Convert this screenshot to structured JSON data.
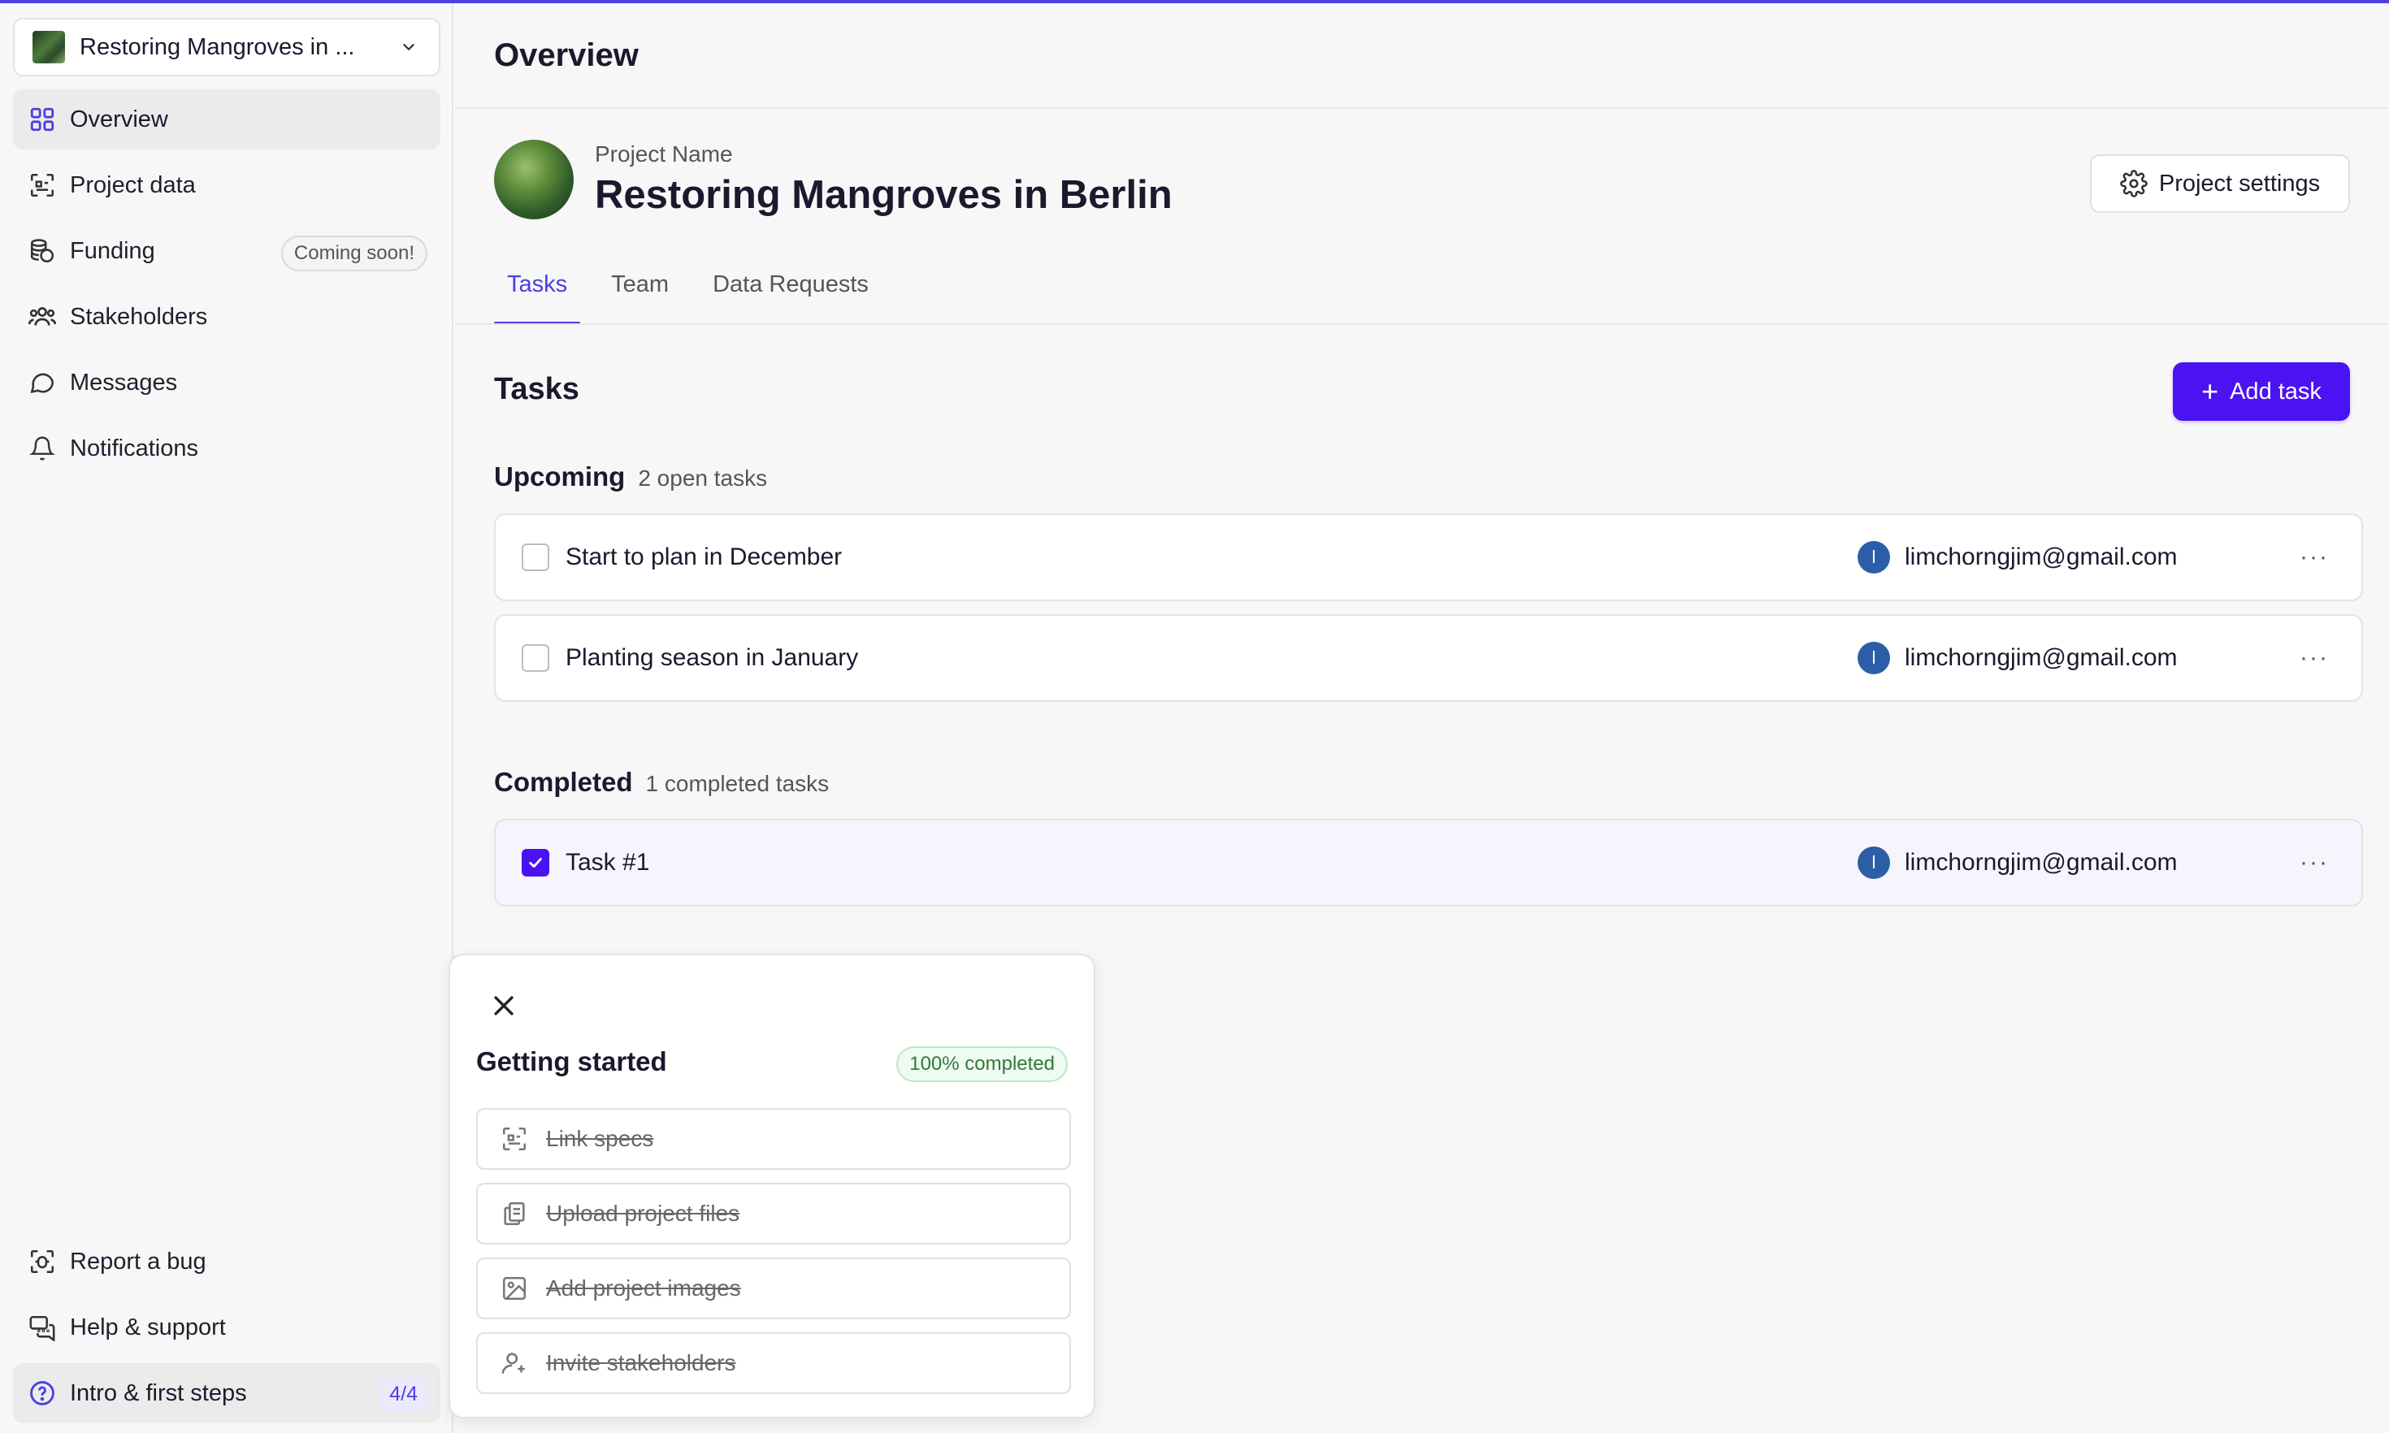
{
  "sidebar": {
    "project_select": "Restoring Mangroves in ...",
    "items": [
      {
        "label": "Overview",
        "icon": "grid-icon"
      },
      {
        "label": "Project data",
        "icon": "data-icon"
      },
      {
        "label": "Funding",
        "icon": "coins-icon",
        "badge": "Coming soon!"
      },
      {
        "label": "Stakeholders",
        "icon": "users-icon"
      },
      {
        "label": "Messages",
        "icon": "message-icon"
      },
      {
        "label": "Notifications",
        "icon": "bell-icon"
      }
    ],
    "bottom_items": [
      {
        "label": "Report a bug",
        "icon": "bug-icon"
      },
      {
        "label": "Help & support",
        "icon": "chat-icon"
      },
      {
        "label": "Intro & first steps",
        "icon": "question-icon",
        "count": "4/4"
      }
    ]
  },
  "header": {
    "title": "Overview"
  },
  "project": {
    "label": "Project Name",
    "name": "Restoring Mangroves in Berlin",
    "settings_label": "Project settings"
  },
  "tabs": [
    "Tasks",
    "Team",
    "Data Requests"
  ],
  "tasks": {
    "title": "Tasks",
    "add_label": "Add task",
    "upcoming": {
      "title": "Upcoming",
      "sub": "2 open tasks",
      "items": [
        {
          "name": "Start to plan in December",
          "assignee": "limchorngjim@gmail.com",
          "initial": "l"
        },
        {
          "name": "Planting season in January",
          "assignee": "limchorngjim@gmail.com",
          "initial": "l"
        }
      ]
    },
    "completed": {
      "title": "Completed",
      "sub": "1 completed tasks",
      "items": [
        {
          "name": "Task #1",
          "assignee": "limchorngjim@gmail.com",
          "initial": "l"
        }
      ]
    },
    "more": "···"
  },
  "getting_started": {
    "title": "Getting started",
    "badge": "100% completed",
    "progress": 1.0,
    "items": [
      {
        "label": "Link specs",
        "icon": "link-specs-icon"
      },
      {
        "label": "Upload project files",
        "icon": "files-icon"
      },
      {
        "label": "Add project images",
        "icon": "image-icon"
      },
      {
        "label": "Invite stakeholders",
        "icon": "user-plus-icon"
      }
    ]
  },
  "colors": {
    "accent": "#4b12f2",
    "success": "#2f7a3c"
  }
}
